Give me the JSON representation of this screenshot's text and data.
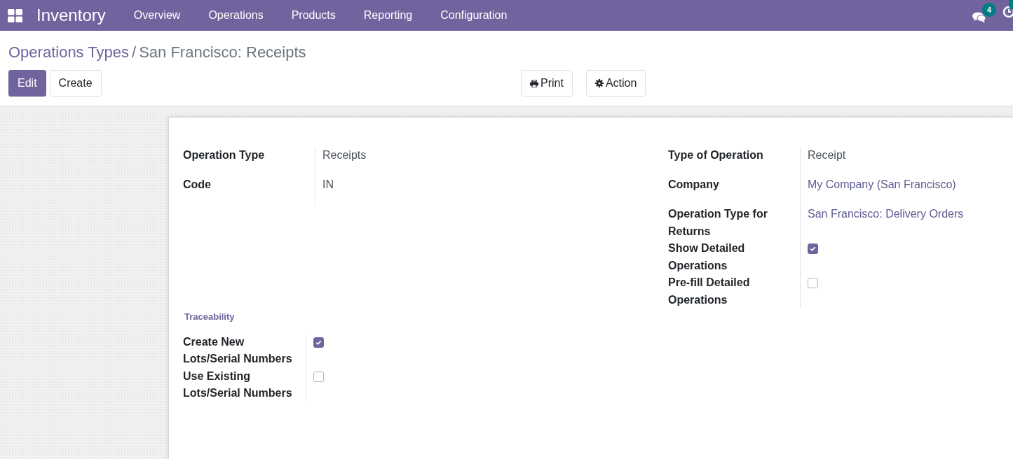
{
  "navbar": {
    "app_name": "Inventory",
    "menu": [
      "Overview",
      "Operations",
      "Products",
      "Reporting",
      "Configuration"
    ],
    "messages_badge": "4"
  },
  "breadcrumb": {
    "parent": "Operations Types",
    "separator": "/",
    "current": "San Francisco: Receipts"
  },
  "buttons": [
    {
      "label": "Edit",
      "kind": "primary"
    },
    {
      "label": "Create",
      "kind": "secondary"
    }
  ],
  "actions": [
    {
      "label": "Print",
      "kind": "print"
    },
    {
      "label": "Action",
      "kind": "gear"
    }
  ],
  "form": {
    "left_fields": [
      {
        "label": "Operation Type",
        "kind": "text",
        "value": "Receipts"
      },
      {
        "label": "Code",
        "kind": "text",
        "value": "IN"
      }
    ],
    "right_fields": [
      {
        "label": "Type of Operation",
        "kind": "text",
        "value": "Receipt"
      },
      {
        "label": "Company",
        "kind": "link",
        "value": "My Company (San Francisco)"
      },
      {
        "label": "Operation Type for Returns",
        "kind": "link",
        "value": "San Francisco: Delivery Orders"
      },
      {
        "label": "Show Detailed Operations",
        "kind": "checkbox",
        "checked": true
      },
      {
        "label": "Pre-fill Detailed Operations",
        "kind": "checkbox",
        "checked": false
      }
    ],
    "traceability": {
      "title": "Traceability",
      "fields": [
        {
          "label": "Create New Lots/Serial Numbers",
          "kind": "checkbox",
          "checked": true
        },
        {
          "label": "Use Existing Lots/Serial Numbers",
          "kind": "checkbox",
          "checked": false
        }
      ]
    }
  }
}
